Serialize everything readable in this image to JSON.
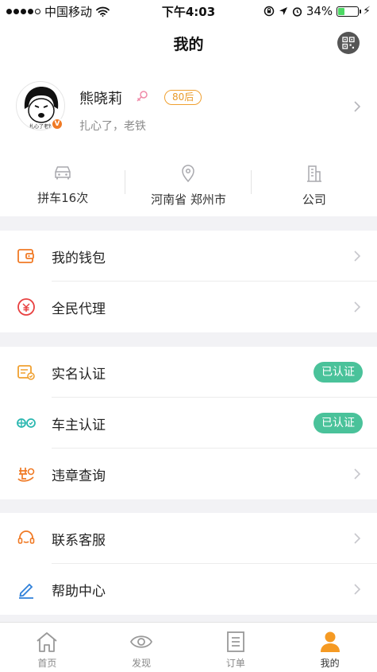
{
  "status_bar": {
    "carrier": "中国移动",
    "time": "下午4:03",
    "battery_percent": "34%",
    "battery_level": 0.34
  },
  "nav": {
    "title": "我的"
  },
  "profile": {
    "name": "熊晓莉",
    "age_badge": "80后",
    "motto": "扎心了，老铁",
    "avatar_caption": "扎心了老铁",
    "verified_mark": "V"
  },
  "stats": [
    {
      "icon": "car-icon",
      "label": "拼车16次"
    },
    {
      "icon": "location-pin-icon",
      "label": "河南省 郑州市"
    },
    {
      "icon": "building-icon",
      "label": "公司"
    }
  ],
  "menu_groups": [
    [
      {
        "icon": "wallet-icon",
        "label": "我的钱包",
        "color": "#f07a25"
      },
      {
        "icon": "coin-icon",
        "label": "全民代理",
        "color": "#e84040"
      }
    ],
    [
      {
        "icon": "id-card-icon",
        "label": "实名认证",
        "badge": "已认证",
        "color": "#f0a030"
      },
      {
        "icon": "car-owner-icon",
        "label": "车主认证",
        "badge": "已认证",
        "color": "#2bb7b0"
      },
      {
        "icon": "violation-icon",
        "label": "违章查询",
        "color": "#f07a25"
      }
    ],
    [
      {
        "icon": "headset-icon",
        "label": "联系客服",
        "color": "#f07a25"
      },
      {
        "icon": "pen-icon",
        "label": "帮助中心",
        "color": "#2f80d9"
      }
    ]
  ],
  "tabs": [
    {
      "icon": "home-icon",
      "label": "首页"
    },
    {
      "icon": "eye-icon",
      "label": "发现"
    },
    {
      "icon": "order-icon",
      "label": "订单"
    },
    {
      "icon": "user-icon",
      "label": "我的",
      "active": true
    }
  ],
  "colors": {
    "accent": "#f59a23",
    "certified": "#4ac29a",
    "chevron": "#c7c7cc"
  }
}
